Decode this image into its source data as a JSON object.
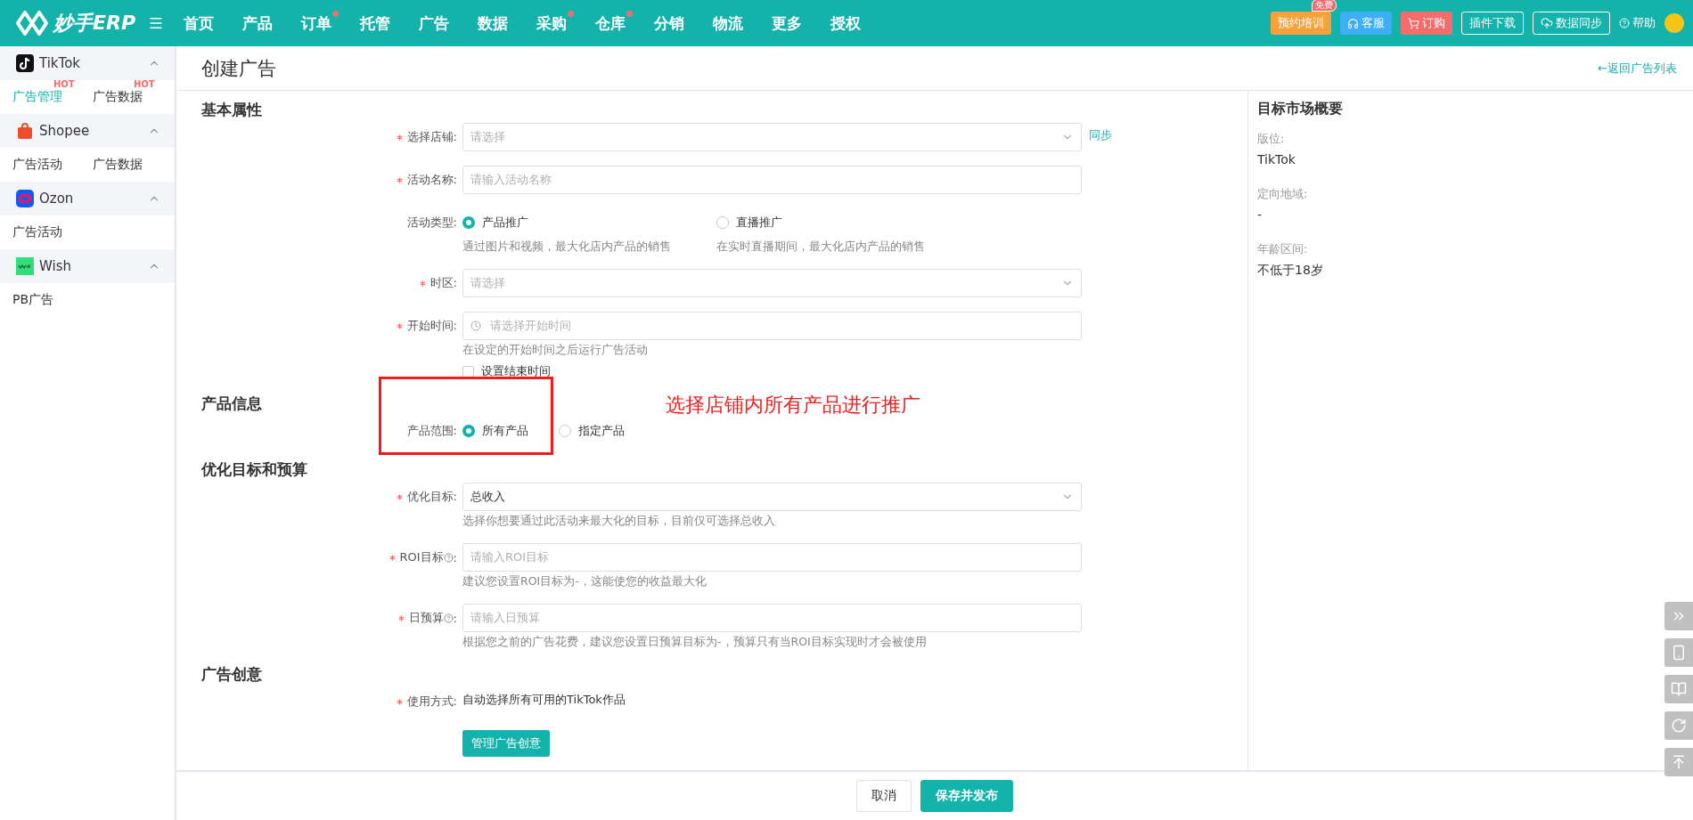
{
  "logo": {
    "text": "妙手ERP"
  },
  "nav": [
    {
      "label": "首页",
      "dot": false
    },
    {
      "label": "产品",
      "dot": false
    },
    {
      "label": "订单",
      "dot": true
    },
    {
      "label": "托管",
      "dot": false
    },
    {
      "label": "广告",
      "dot": false
    },
    {
      "label": "数据",
      "dot": false
    },
    {
      "label": "采购",
      "dot": true
    },
    {
      "label": "仓库",
      "dot": true
    },
    {
      "label": "分销",
      "dot": false
    },
    {
      "label": "物流",
      "dot": false
    },
    {
      "label": "更多",
      "dot": false
    },
    {
      "label": "授权",
      "dot": false
    }
  ],
  "header_actions": [
    {
      "kind": "training",
      "label": "预约培训",
      "badge": "免费"
    },
    {
      "kind": "service",
      "label": "客服"
    },
    {
      "kind": "order",
      "label": "订购"
    },
    {
      "kind": "outline",
      "label": "插件下载"
    },
    {
      "kind": "sync",
      "label": "数据同步"
    },
    {
      "kind": "help",
      "label": "帮助"
    }
  ],
  "sidebar": [
    {
      "kind": "tiktok",
      "name": "TikTok",
      "expanded": true,
      "items": [
        {
          "label": "广告管理",
          "selected": true,
          "badge": "HOT"
        },
        {
          "label": "广告数据",
          "selected": false,
          "badge": "HOT"
        }
      ]
    },
    {
      "kind": "shopee",
      "name": "Shopee",
      "expanded": true,
      "items": [
        {
          "label": "广告活动",
          "selected": false
        },
        {
          "label": "广告数据",
          "selected": false
        }
      ]
    },
    {
      "kind": "ozon",
      "name": "Ozon",
      "expanded": true,
      "items": [
        {
          "label": "广告活动",
          "selected": false
        }
      ]
    },
    {
      "kind": "wish",
      "name": "Wish",
      "expanded": true,
      "items": [
        {
          "label": "PB广告",
          "selected": false
        }
      ]
    }
  ],
  "page": {
    "title": "创建广告",
    "back_link": "←返回广告列表"
  },
  "sections": [
    {
      "title": "基本属性",
      "fields": [
        {
          "kind": "select",
          "label": "选择店铺:",
          "required": true,
          "placeholder": "请选择",
          "link": "同步"
        },
        {
          "kind": "input",
          "label": "活动名称:",
          "required": true,
          "placeholder": "请输入活动名称"
        },
        {
          "kind": "radio",
          "label": "活动类型:",
          "required": false,
          "options": [
            {
              "label": "产品推广",
              "description": "通过图片和视频，最大化店内产品的销售",
              "selected": true
            },
            {
              "label": "直播推广",
              "description": "在实时直播期间，最大化店内产品的销售",
              "selected": false
            }
          ]
        },
        {
          "kind": "select",
          "label": "时区:",
          "required": true,
          "placeholder": "请选择"
        },
        {
          "kind": "datetime",
          "label": "开始时间:",
          "required": true,
          "placeholder": "请选择开始时间",
          "hint": "在设定的开始时间之后运行广告活动",
          "checkbox": {
            "label": "设置结束时间",
            "checked": false
          }
        }
      ]
    },
    {
      "title": "产品信息",
      "fields": [
        {
          "kind": "radio",
          "label": "产品范围:",
          "required": false,
          "options": [
            {
              "label": "所有产品",
              "selected": true
            },
            {
              "label": "指定产品",
              "selected": false
            }
          ]
        }
      ]
    },
    {
      "title": "优化目标和预算",
      "fields": [
        {
          "kind": "select",
          "label": "优化目标:",
          "required": true,
          "value": "总收入",
          "hint": "选择你想要通过此活动来最大化的目标，目前仅可选择总收入"
        },
        {
          "kind": "input",
          "label": "ROI目标",
          "help": true,
          "suffix": ":",
          "required": true,
          "placeholder": "请输入ROI目标",
          "hint": "建议您设置ROI目标为-，这能使您的收益最大化"
        },
        {
          "kind": "input",
          "label": "日预算",
          "help": true,
          "suffix": ":",
          "required": true,
          "placeholder": "请输入日预算",
          "hint": "根据您之前的广告花费，建议您设置日预算目标为-，预算只有当ROI目标实现时才会被使用"
        }
      ]
    },
    {
      "title": "广告创意",
      "fields": [
        {
          "kind": "text",
          "label": "使用方式:",
          "required": true,
          "value": "自动选择所有可用的TikTok作品"
        },
        {
          "kind": "button",
          "label": "管理广告创意"
        }
      ]
    }
  ],
  "annotation": {
    "text": "选择店铺内所有产品进行推广"
  },
  "summary": {
    "title": "目标市场概要",
    "items": [
      {
        "label": "版位:",
        "value": "TikTok"
      },
      {
        "label": "定向地域:",
        "value": "-"
      },
      {
        "label": "年龄区间:",
        "value": "不低于18岁"
      }
    ]
  },
  "footer": {
    "buttons": [
      {
        "kind": "default",
        "label": "取消"
      },
      {
        "kind": "primary",
        "label": "保存并发布"
      }
    ]
  },
  "side_tools": [
    {
      "kind": "expand"
    },
    {
      "kind": "phone"
    },
    {
      "kind": "help"
    },
    {
      "kind": "refresh"
    },
    {
      "kind": "top"
    }
  ]
}
